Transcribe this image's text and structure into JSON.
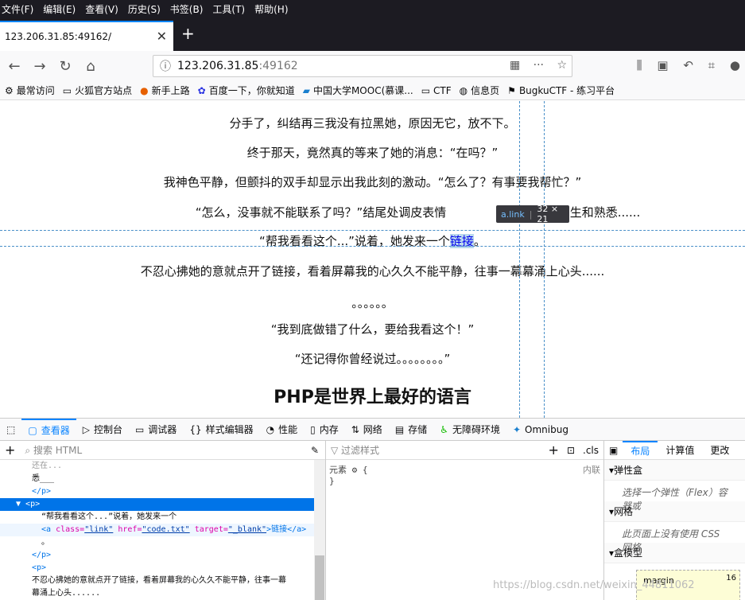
{
  "menubar": [
    "文件(F)",
    "编辑(E)",
    "查看(V)",
    "历史(S)",
    "书签(B)",
    "工具(T)",
    "帮助(H)"
  ],
  "tab": {
    "title": "123.206.31.85:49162/"
  },
  "urlbar": {
    "host": "123.206.31.85",
    "port": ":49162"
  },
  "bookmarks": [
    {
      "icon": "gear-icon",
      "label": "最常访问"
    },
    {
      "icon": "folder-icon",
      "label": "火狐官方站点"
    },
    {
      "icon": "firefox-icon",
      "label": "新手上路"
    },
    {
      "icon": "baidu-icon",
      "label": "百度一下，你就知道"
    },
    {
      "icon": "mooc-icon",
      "label": "中国大学MOOC(慕课..."
    },
    {
      "icon": "folder-icon",
      "label": "CTF"
    },
    {
      "icon": "globe-icon",
      "label": "信息页"
    },
    {
      "icon": "flag-icon",
      "label": "BugkuCTF - 练习平台"
    }
  ],
  "content": {
    "lines": [
      "分手了，纠结再三我没有拉黑她，原因无它，放不下。",
      "终于那天，竟然真的等来了她的消息：“在吗？”",
      "我神色平静，但颤抖的双手却显示出我此刻的激动。“怎么了？有事要我帮忙？”",
      "“怎么，没事就不能联系了吗？”结尾处调皮表情",
      "陌生和熟悉......"
    ],
    "link_prefix": "“帮我看看这个...”说着，她发来一个",
    "link_text": "链接",
    "link_suffix": "。",
    "more_lines": [
      "不忍心拂她的意就点开了链接，看着屏幕我的心久久不能平静，往事一幕幕涌上心头......",
      "。。。。。。",
      "“我到底做错了什么，要给我看这个！”",
      "“还记得你曾经说过。。。。。。。。”"
    ],
    "heading": "PHP是世界上最好的语言"
  },
  "tooltip": {
    "tag": "a.link",
    "size": "32 × 21"
  },
  "devtools": {
    "tabs": [
      {
        "icon": "inspector-icon",
        "label": "查看器"
      },
      {
        "icon": "console-icon",
        "label": "控制台"
      },
      {
        "icon": "debugger-icon",
        "label": "调试器"
      },
      {
        "icon": "style-editor-icon",
        "label": "样式编辑器"
      },
      {
        "icon": "performance-icon",
        "label": "性能"
      },
      {
        "icon": "memory-icon",
        "label": "内存"
      },
      {
        "icon": "network-icon",
        "label": "网络"
      },
      {
        "icon": "storage-icon",
        "label": "存储"
      },
      {
        "icon": "accessibility-icon",
        "label": "无障碍环境"
      },
      {
        "icon": "omnibug-icon",
        "label": "Omnibug"
      }
    ],
    "search_html": "搜索 HTML",
    "filter_styles": "过滤样式",
    "cls": ".cls",
    "tree": {
      "line0": "还在...",
      "line1": "悉___",
      "close_p": "</p>",
      "open_p": "<p>",
      "text1": "“帮我看看这个...”说着，她发来一个",
      "a_open": "<a",
      "attr_class": "class=",
      "val_class": "\"link\"",
      "attr_href": "href=",
      "val_href": "\"code.txt\"",
      "attr_target": "target=",
      "val_target": "\"_blank\"",
      "a_text": ">链接</a>",
      "dot": "。",
      "text2": "不忍心拂她的意就点开了链接，看着屏幕我的心久久不能平静，往事一幕",
      "text3": "幕涌上心头......"
    },
    "rule": {
      "selector": "元素 ⚙ {",
      "source": "内联",
      "close": "}"
    },
    "right_tabs": [
      "布局",
      "计算值",
      "更改"
    ],
    "sections": [
      {
        "title": "弹性盒",
        "body": "选择一个弹性（Flex）容器或"
      },
      {
        "title": "网格",
        "body": "此页面上没有使用 CSS 网格"
      },
      {
        "title": "盒模型",
        "body": ""
      }
    ],
    "box": {
      "label": "margin",
      "value": "16"
    }
  },
  "watermark": "https://blog.csdn.net/weixin_44811062"
}
